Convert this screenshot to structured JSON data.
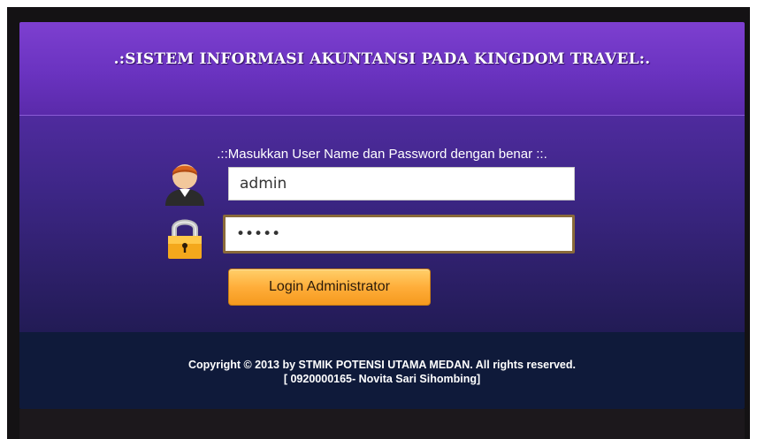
{
  "header": {
    "title": ".:SISTEM INFORMASI AKUNTANSI PADA KINGDOM TRAVEL:."
  },
  "login": {
    "instruction": ".::Masukkan User Name dan Password dengan benar ::.",
    "username_value": "admin",
    "password_value": "12345",
    "button_label": "Login Administrator"
  },
  "icons": {
    "user": "user-avatar-icon",
    "lock": "padlock-icon"
  },
  "footer": {
    "copyright": "Copyright © 2013 by STMIK POTENSI UTAMA MEDAN. All rights reserved.",
    "author": "[ 0920000165- Novita Sari Sihombing]"
  },
  "colors": {
    "header": "#7d3fd0",
    "body": "#3d2686",
    "footer": "#0f1a3a",
    "button": "#ffae3a"
  }
}
